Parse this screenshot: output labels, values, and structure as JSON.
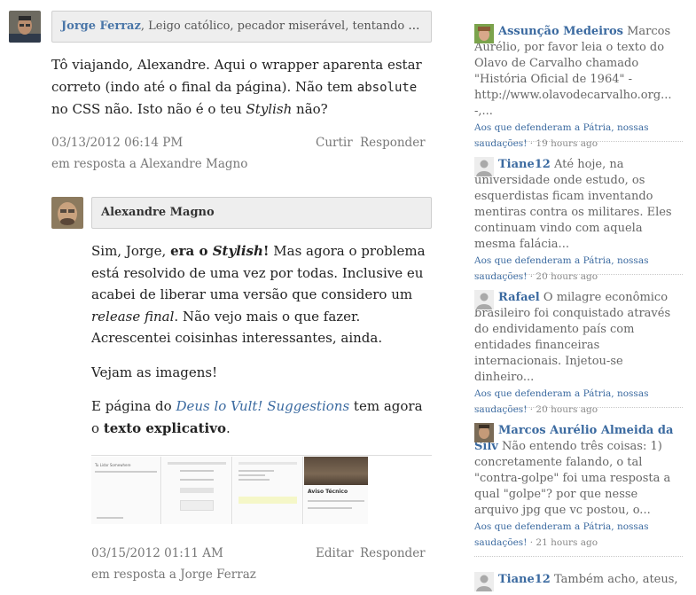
{
  "comments": [
    {
      "author": "Jorge Ferraz",
      "bio": ", Leigo católico, pecador miserável, tentando colocar a...",
      "text_1": "Tô viajando, Alexandre. Aqui o wrapper aparenta estar correto (indo até o final da página). Não tem ",
      "code": "absolute",
      "text_2": " no CSS não. Isto não é o teu ",
      "em": "Stylish",
      "text_3": " não?",
      "date": "03/13/2012 06:14 PM",
      "action": "Curtir",
      "reply": "Responder",
      "in_reply_to": "em resposta a Alexandre Magno"
    },
    {
      "author": "Alexandre Magno",
      "p1_a": " Sim, Jorge, ",
      "p1_b": "era o ",
      "p1_c": "Stylish",
      "p1_d": "!",
      "p1_e": " Mas agora o problema está resolvido de uma vez por todas. Inclusive eu acabei de liberar uma versão que considero um ",
      "p1_f": "release final",
      "p1_g": ". Não vejo mais o que fazer. Acrescentei coisinhas interessantes, ainda.",
      "p2": "Vejam as imagens!",
      "p3_a": "E página do ",
      "p3_link": "Deus lo Vult! Suggestions",
      "p3_b": " tem agora o ",
      "p3_strong": "texto explicativo",
      "p3_c": ".",
      "thumbs": [
        "Tu Lidar Somewhere",
        "Aviso Técnico"
      ],
      "date": "03/15/2012 01:11 AM",
      "action": "Editar",
      "reply": "Responder",
      "in_reply_to": "em resposta a Jorge Ferraz"
    }
  ],
  "sidebar": {
    "items": [
      {
        "name": "Assunção Medeiros",
        "text": " Marcos Aurélio, por favor leia o texto do Olavo de Carvalho chamado \"História Oficial de 1964\" - http://www.olavodecarvalho.org... -,...",
        "link": "Aos que defenderam a Pátria, nossas saudações!",
        "ago": " · 19 hours ago",
        "avatar": "photo"
      },
      {
        "name": "Tiane12",
        "text": " Até hoje, na universidade onde estudo, os esquerdistas ficam inventando mentiras contra os militares. Eles continuam vindo com aquela mesma falácia...",
        "link": "Aos que defenderam a Pátria, nossas saudações!",
        "ago": " · 20 hours ago",
        "avatar": "default"
      },
      {
        "name": "Rafael",
        "text": " O milagre econômico brasileiro foi conquistado através do endividamento país com entidades financeiras internacionais. Injetou-se dinheiro...",
        "link": "Aos que defenderam a Pátria, nossas saudações!",
        "ago": " · 20 hours ago",
        "avatar": "default"
      },
      {
        "name": "Marcos Aurélio Almeida da Silv",
        "text": " Não entendo três coisas: 1) concretamente falando, o tal \"contra-golpe\" foi uma resposta a qual \"golpe\"? por que nesse arquivo jpg que vc postou, o...",
        "link": "Aos que defenderam a Pátria, nossas saudações!",
        "ago": " · 21 hours ago",
        "avatar": "photo2"
      },
      {
        "name": "Tiane12",
        "text": " Também acho, ateus,",
        "avatar": "default"
      }
    ]
  }
}
